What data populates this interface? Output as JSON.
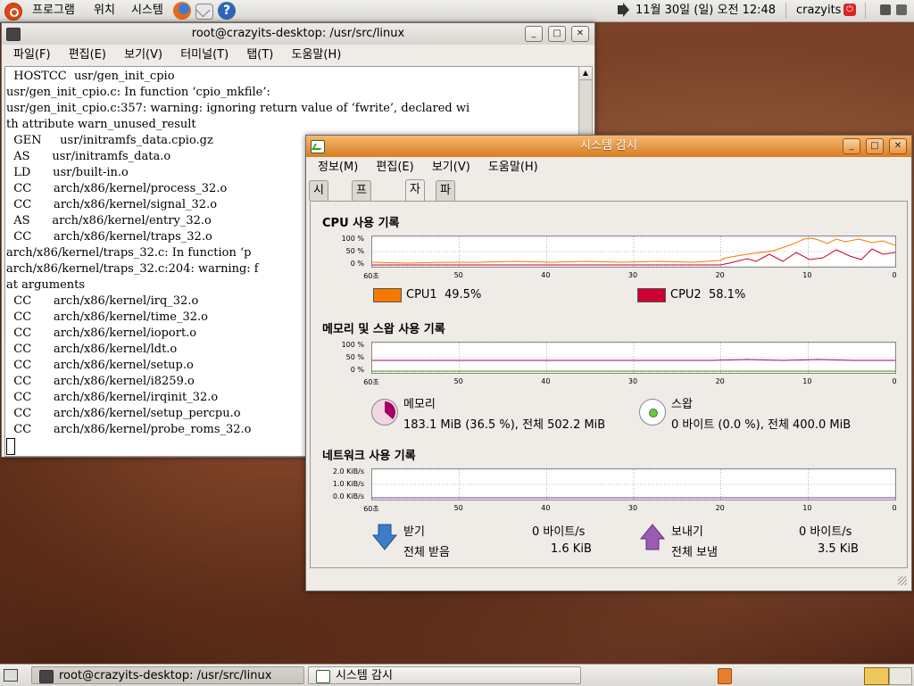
{
  "top_panel": {
    "menus": [
      "프로그램",
      "위치",
      "시스템"
    ],
    "clock": "11월 30일 (일) 오전 12:48",
    "user": "crazyits"
  },
  "terminal": {
    "title": "root@crazyits-desktop: /usr/src/linux",
    "menu": [
      "파일(F)",
      "편집(E)",
      "보기(V)",
      "터미널(T)",
      "탭(T)",
      "도움말(H)"
    ],
    "lines": [
      "  HOSTCC  usr/gen_init_cpio",
      "usr/gen_init_cpio.c: In function ‘cpio_mkfile’:",
      "usr/gen_init_cpio.c:357: warning: ignoring return value of ‘fwrite’, declared wi",
      "th attribute warn_unused_result",
      "  GEN     usr/initramfs_data.cpio.gz",
      "  AS      usr/initramfs_data.o",
      "  LD      usr/built-in.o",
      "  CC      arch/x86/kernel/process_32.o",
      "  CC      arch/x86/kernel/signal_32.o",
      "  AS      arch/x86/kernel/entry_32.o",
      "  CC      arch/x86/kernel/traps_32.o",
      "arch/x86/kernel/traps_32.c: In function ‘p",
      "arch/x86/kernel/traps_32.c:204: warning: f",
      "at arguments",
      "  CC      arch/x86/kernel/irq_32.o",
      "  CC      arch/x86/kernel/time_32.o",
      "  CC      arch/x86/kernel/ioport.o",
      "  CC      arch/x86/kernel/ldt.o",
      "  CC      arch/x86/kernel/setup.o",
      "  CC      arch/x86/kernel/i8259.o",
      "  CC      arch/x86/kernel/irqinit_32.o",
      "  CC      arch/x86/kernel/setup_percpu.o",
      "  CC      arch/x86/kernel/probe_roms_32.o"
    ]
  },
  "sysmon": {
    "title": "시스템 감시",
    "menu": [
      "정보(M)",
      "편집(E)",
      "보기(V)",
      "도움말(H)"
    ],
    "tabs": [
      "시스템",
      "프로세스",
      "자원",
      "파일시스템"
    ],
    "active_tab": "자원",
    "x_ticks": [
      "60초",
      "50",
      "40",
      "30",
      "20",
      "10",
      "0"
    ],
    "cpu": {
      "title": "CPU 사용 기록",
      "y_ticks": [
        "100 %",
        "50 %",
        "0 %"
      ],
      "cpu1_label": "CPU1",
      "cpu1_value": "49.5%",
      "cpu1_color": "#f57900",
      "cpu2_label": "CPU2",
      "cpu2_value": "58.1%",
      "cpu2_color": "#cc0033"
    },
    "memory": {
      "title": "메모리 및 스왑 사용 기록",
      "y_ticks": [
        "100 %",
        "50 %",
        "0 %"
      ],
      "mem_label": "메모리",
      "mem_value": "183.1 MiB (36.5 %), 전체 502.2 MiB",
      "mem_color": "#a40062",
      "mem_fraction": 0.365,
      "swap_label": "스왑",
      "swap_value": "0 바이트 (0.0 %), 전체 400.0 MiB",
      "swap_color": "#4e9a06"
    },
    "network": {
      "title": "네트워크 사용 기록",
      "y_ticks": [
        "2.0 KiB/s",
        "1.0 KiB/s",
        "0.0 KiB/s"
      ],
      "recv_label": "받기",
      "recv_rate": "0 바이트/s",
      "recv_total_label": "전체 받음",
      "recv_total": "1.6 KiB",
      "send_label": "보내기",
      "send_rate": "0 바이트/s",
      "send_total_label": "전체 보냄",
      "send_total": "3.5 KiB",
      "recv_color": "#2e5e9e",
      "send_color": "#7b3b98"
    }
  },
  "taskbar": {
    "tasks": [
      "root@crazyits-desktop: /usr/src/linux",
      "시스템 감시"
    ]
  }
}
